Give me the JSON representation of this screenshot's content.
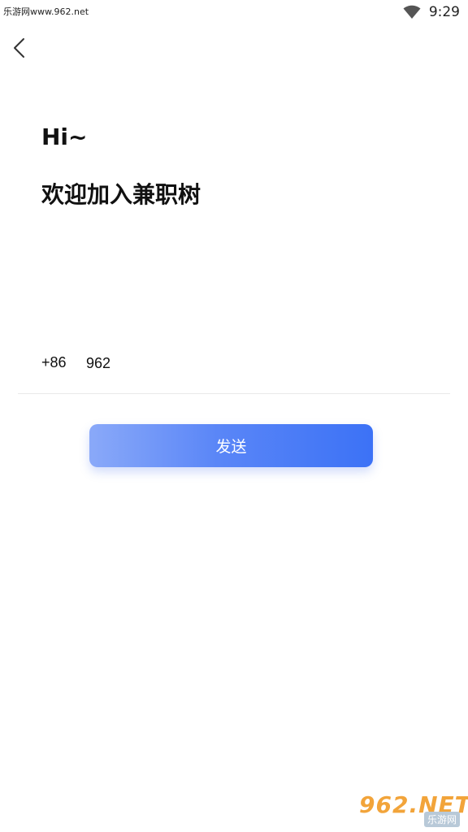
{
  "status_bar": {
    "watermark": "乐游网www.962.net",
    "time": "9:29",
    "wifi_icon": "wifi-icon"
  },
  "nav": {
    "back_icon": "chevron-left-icon"
  },
  "heading": {
    "greeting": "Hi~",
    "welcome": "欢迎加入兼职树"
  },
  "phone": {
    "country_code": "+86",
    "value": "962"
  },
  "actions": {
    "send_label": "发送"
  },
  "watermark_logo": {
    "brand": "962.NET",
    "sub": "乐游网"
  },
  "colors": {
    "accent_start": "#8aa9f9",
    "accent_end": "#3c72f6",
    "logo": "#f2a43a"
  }
}
